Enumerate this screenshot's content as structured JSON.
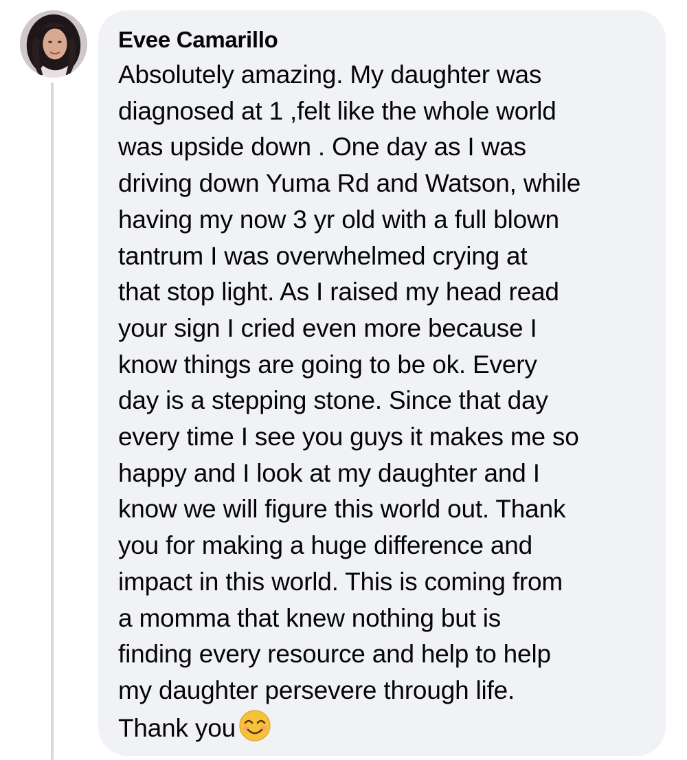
{
  "comment": {
    "author": "Evee Camarillo",
    "text": "Absolutely amazing. My daughter was\ndiagnosed at 1 ,felt like the whole world\nwas upside down .  One day as I was\ndriving down Yuma Rd and Watson, while\nhaving my now 3 yr old with a full blown\ntantrum I was overwhelmed crying at\nthat stop light. As I raised my head read\nyour sign I cried even more because I\nknow things are going to be ok. Every\nday is a stepping stone. Since that day\nevery time I see you guys it makes me so\nhappy and I look at my daughter and I\nknow we will figure this world out. Thank\nyou for making a huge difference and\nimpact in this world. This is coming from\na momma that knew nothing but is\nfinding every resource and help to help\nmy daughter persevere through life.\nThank you",
    "emoji": "smiling-face-with-smiling-eyes-icon"
  },
  "colors": {
    "bubble_background": "#f0f2f5",
    "text": "#050505",
    "thread_line": "#d6d8de"
  }
}
